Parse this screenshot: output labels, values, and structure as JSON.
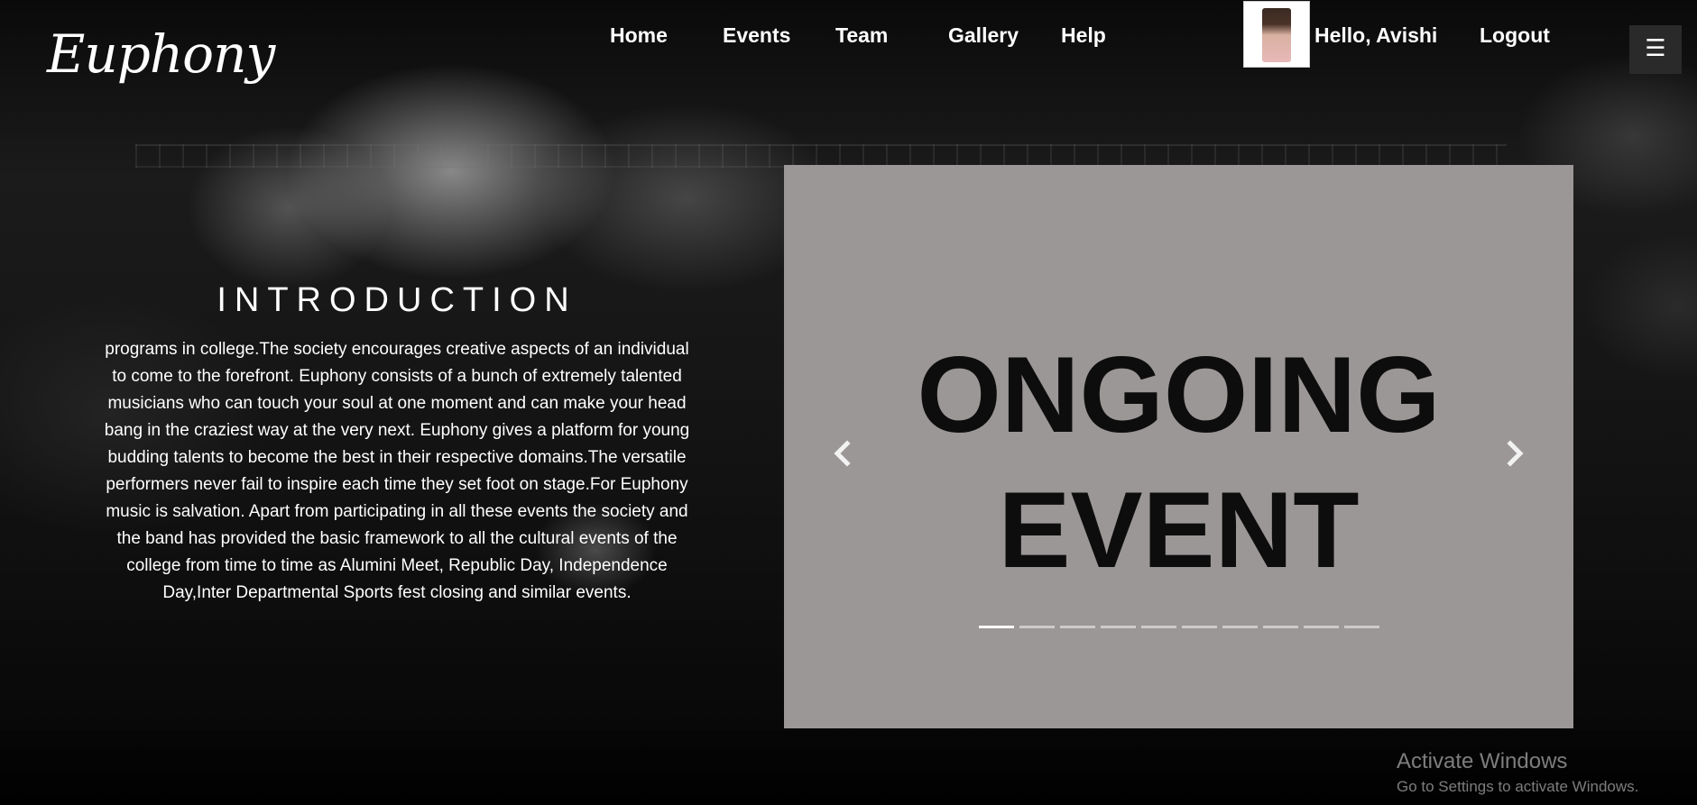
{
  "brand": {
    "logo_text": "Euphony"
  },
  "nav": {
    "items": [
      {
        "label": "Home"
      },
      {
        "label": "Events"
      },
      {
        "label": "Team"
      },
      {
        "label": "Gallery"
      },
      {
        "label": "Help"
      }
    ],
    "greeting": "Hello, Avishi",
    "logout_label": "Logout",
    "menu_icon": "☰"
  },
  "intro": {
    "title": "INTRODUCTION",
    "body": "programs in college.The society encourages creative aspects of an individual to come to the forefront. Euphony consists of a bunch of extremely talented musicians who can touch your soul at one moment and can make your head bang in the craziest way at the very next. Euphony gives a platform for young budding talents to become the best in their respective domains.The versatile performers never fail to inspire each time they set foot on stage.For Euphony music is salvation. Apart from participating in all these events the society and the band has provided the basic framework to all the cultural events of the college from time to time as Alumini Meet, Republic Day, Independence Day,Inter Departmental Sports fest closing and similar events."
  },
  "carousel": {
    "slide_line1": "ONGOING",
    "slide_line2": "EVENT",
    "background_color": "#9b9796",
    "prev_icon": "chevron-left-icon",
    "next_icon": "chevron-right-icon",
    "indicator_count": 10,
    "active_index": 0
  },
  "watermark": {
    "line1": "Activate Windows",
    "line2": "Go to Settings to activate Windows."
  }
}
